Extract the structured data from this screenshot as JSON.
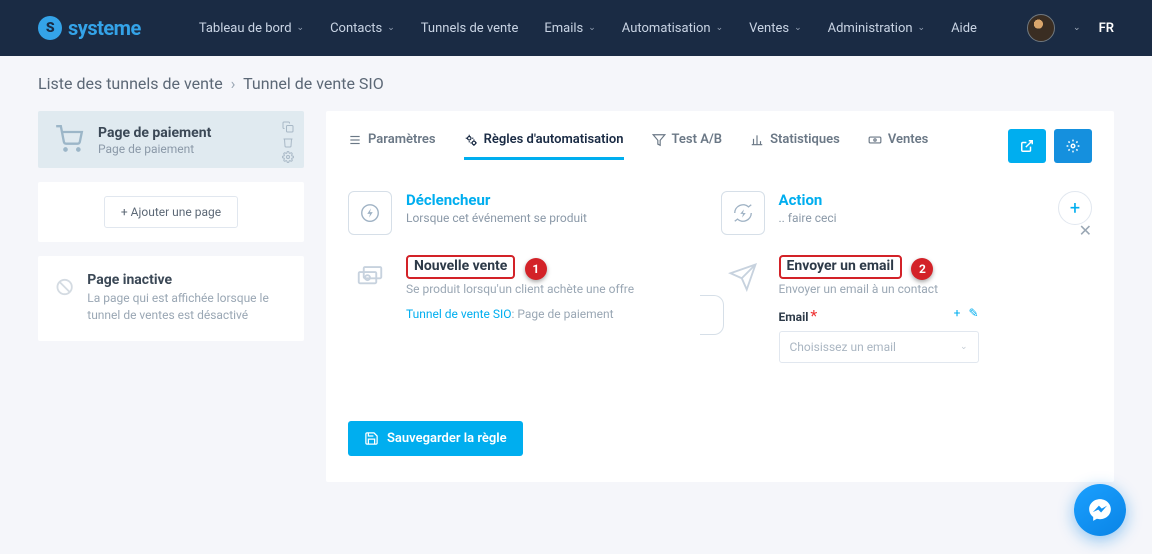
{
  "brand": "systeme",
  "nav": {
    "items": [
      "Tableau de bord",
      "Contacts",
      "Tunnels de vente",
      "Emails",
      "Automatisation",
      "Ventes",
      "Administration",
      "Aide"
    ],
    "lang": "FR"
  },
  "breadcrumb": {
    "root": "Liste des tunnels de vente",
    "current": "Tunnel de vente SIO"
  },
  "sidebar": {
    "page": {
      "title": "Page de paiement",
      "sub": "Page de paiement"
    },
    "add_label": "+  Ajouter une page",
    "inactive": {
      "title": "Page inactive",
      "desc": "La page qui est affichée lorsque le tunnel de ventes est désactivé"
    }
  },
  "tabs": {
    "settings": "Paramètres",
    "rules": "Règles d'automatisation",
    "ab": "Test A/B",
    "stats": "Statistiques",
    "sales": "Ventes"
  },
  "trigger": {
    "heading": "Déclencheur",
    "sub": "Lorsque cet événement se produit",
    "item_title": "Nouvelle vente",
    "item_sub": "Se produit lorsqu'un client achète une offre",
    "tunnel_link": "Tunnel de vente SIO",
    "tunnel_after": ": Page de paiement"
  },
  "action": {
    "heading": "Action",
    "sub": ".. faire ceci",
    "item_title": "Envoyer un email",
    "item_sub": "Envoyer un email à un contact",
    "field_label": "Email",
    "field_placeholder": "Choisissez un email"
  },
  "callouts": {
    "one": "1",
    "two": "2"
  },
  "save": "Sauvegarder la règle"
}
